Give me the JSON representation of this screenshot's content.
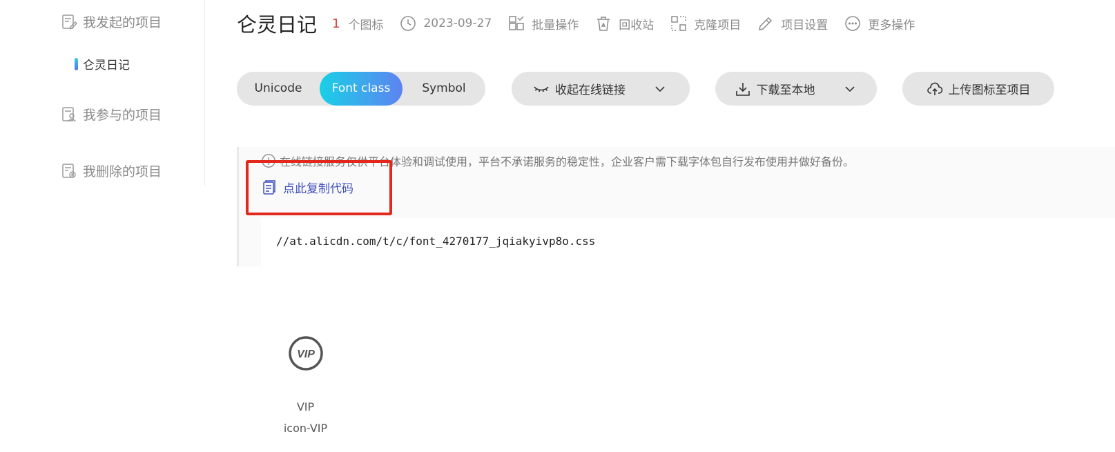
{
  "sidebar": {
    "my_projects": "我发起的项目",
    "sub_project": "仑灵日记",
    "participated": "我参与的项目",
    "deleted": "我删除的项目"
  },
  "header": {
    "title": "仑灵日记",
    "icon_count": "1",
    "icon_count_suffix": "个图标",
    "date": "2023-09-27",
    "batch": "批量操作",
    "recycle": "回收站",
    "clone": "克隆项目",
    "settings": "项目设置",
    "more": "更多操作"
  },
  "tabs": {
    "unicode": "Unicode",
    "font_class": "Font class",
    "symbol": "Symbol",
    "active": "Font class"
  },
  "actions": {
    "collapse": "收起在线链接",
    "download": "下载至本地",
    "upload": "上传图标至项目"
  },
  "panel": {
    "notice": "在线链接服务仅供平台体验和调试使用，平台不承诺服务的稳定性，企业客户需下载字体包自行发布使用并做好备份。",
    "copy": "点此复制代码",
    "code": "//at.alicdn.com/t/c/font_4270177_jqiakyivp8o.css"
  },
  "icons": [
    {
      "glyph": "VIP",
      "name": "VIP",
      "class": "icon-VIP"
    }
  ],
  "colors": {
    "accent_start": "#18d0e6",
    "accent_end": "#5e83f2",
    "highlight": "#e3271d",
    "link": "#3e4fbf",
    "count": "#d9372b"
  }
}
